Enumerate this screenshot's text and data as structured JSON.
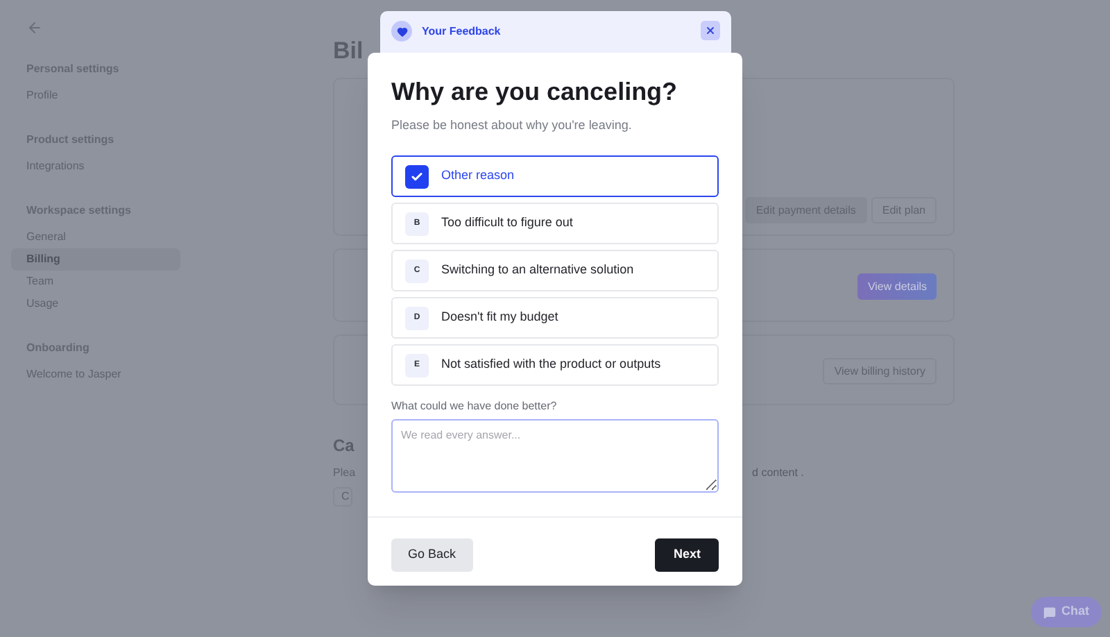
{
  "sidebar": {
    "sections": [
      {
        "title": "Personal settings",
        "items": [
          {
            "label": "Profile",
            "selected": false
          }
        ]
      },
      {
        "title": "Product settings",
        "items": [
          {
            "label": "Integrations",
            "selected": false
          }
        ]
      },
      {
        "title": "Workspace settings",
        "items": [
          {
            "label": "General",
            "selected": false
          },
          {
            "label": "Billing",
            "selected": true
          },
          {
            "label": "Team",
            "selected": false
          },
          {
            "label": "Usage",
            "selected": false
          }
        ]
      },
      {
        "title": "Onboarding",
        "items": [
          {
            "label": "Welcome to Jasper",
            "selected": false
          }
        ]
      }
    ]
  },
  "page": {
    "title": "Bil",
    "cards": [
      {
        "buttons": [
          {
            "label": "Edit payment details",
            "kind": "secondary"
          },
          {
            "label": "Edit plan",
            "kind": "outline"
          }
        ]
      },
      {
        "buttons": [
          {
            "label": "View details",
            "kind": "gradient"
          }
        ]
      },
      {
        "buttons": [
          {
            "label": "View billing history",
            "kind": "outline"
          }
        ]
      }
    ],
    "cancel_section": {
      "title": "Ca",
      "text_left": "Plea",
      "text_right": "d content .",
      "button": "C"
    }
  },
  "modal": {
    "header": "Your Feedback",
    "title": "Why are you canceling?",
    "subtitle": "Please be honest about why you're leaving.",
    "options": [
      {
        "label": "Other reason",
        "selected": true
      },
      {
        "key": "B",
        "label": "Too difficult to figure out",
        "selected": false
      },
      {
        "key": "C",
        "label": "Switching to an alternative solution",
        "selected": false
      },
      {
        "key": "D",
        "label": "Doesn't fit my budget",
        "selected": false
      },
      {
        "key": "E",
        "label": "Not satisfied with the product or outputs",
        "selected": false
      }
    ],
    "feedback": {
      "label": "What could we have done better?",
      "placeholder": "We read every answer..."
    },
    "back_button": "Go Back",
    "next_button": "Next"
  },
  "chat_button": "Chat"
}
